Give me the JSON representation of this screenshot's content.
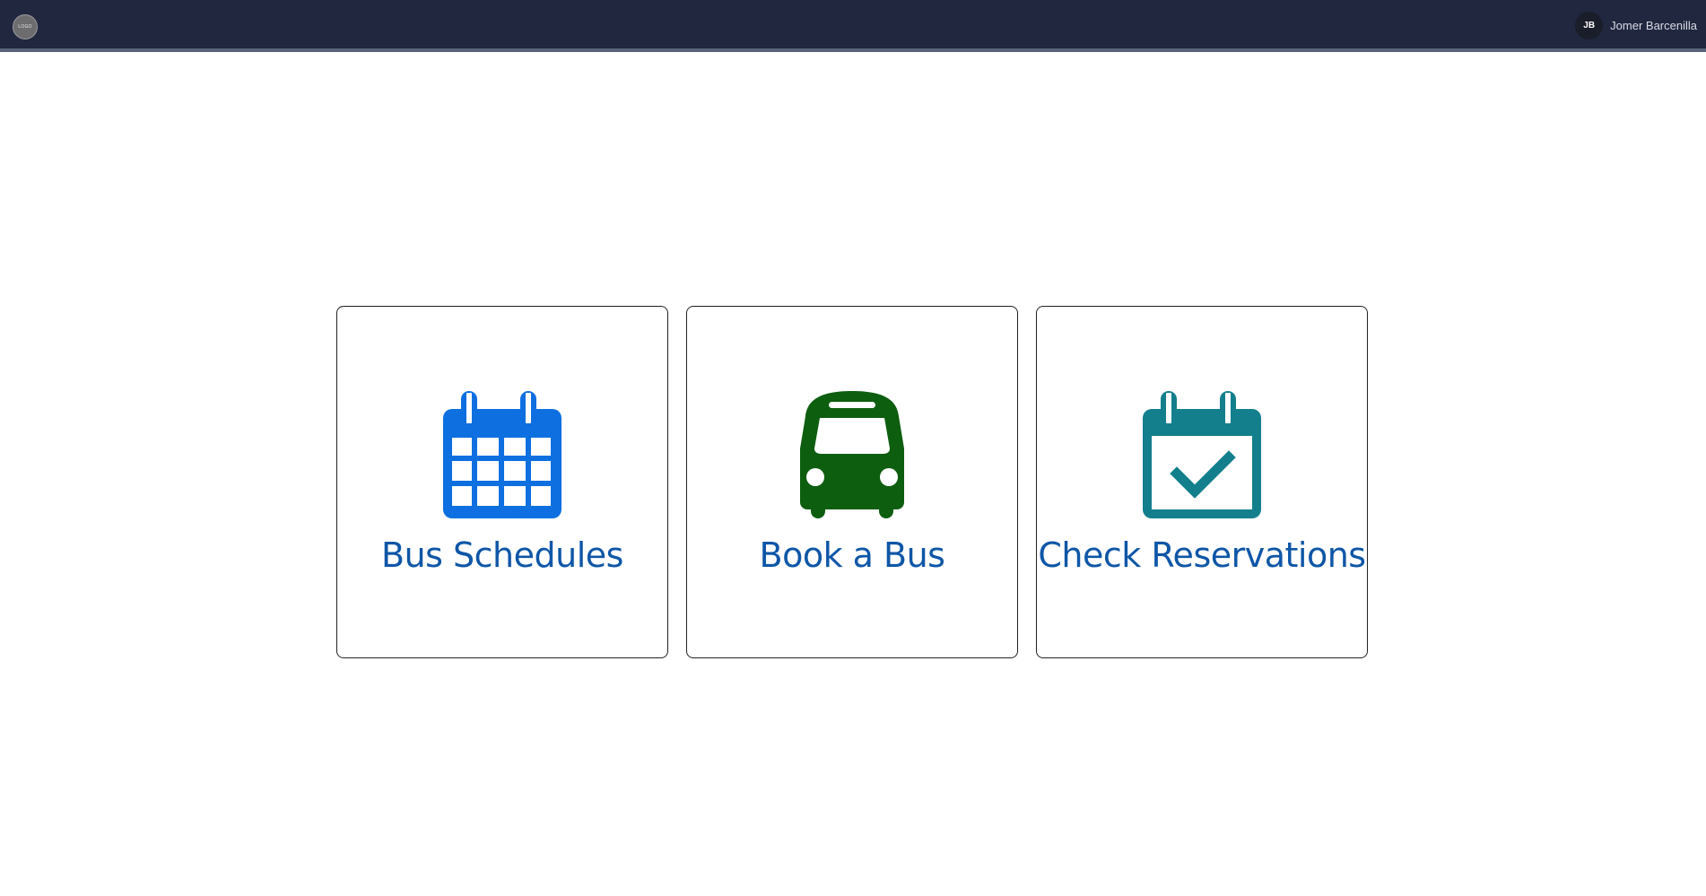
{
  "header": {
    "logo_text": "LOGO",
    "user_initials": "JB",
    "user_name": "Jomer Barcenilla",
    "background": "#222740"
  },
  "cards": [
    {
      "label": "Bus Schedules",
      "icon": "calendar-icon",
      "color": "#0d6fe0"
    },
    {
      "label": "Book a Bus",
      "icon": "bus-icon",
      "color": "#0e5e10"
    },
    {
      "label": "Check Reservations",
      "icon": "calendar-check-icon",
      "color": "#137f8d"
    }
  ],
  "colors": {
    "label_text": "#0e56a7"
  }
}
